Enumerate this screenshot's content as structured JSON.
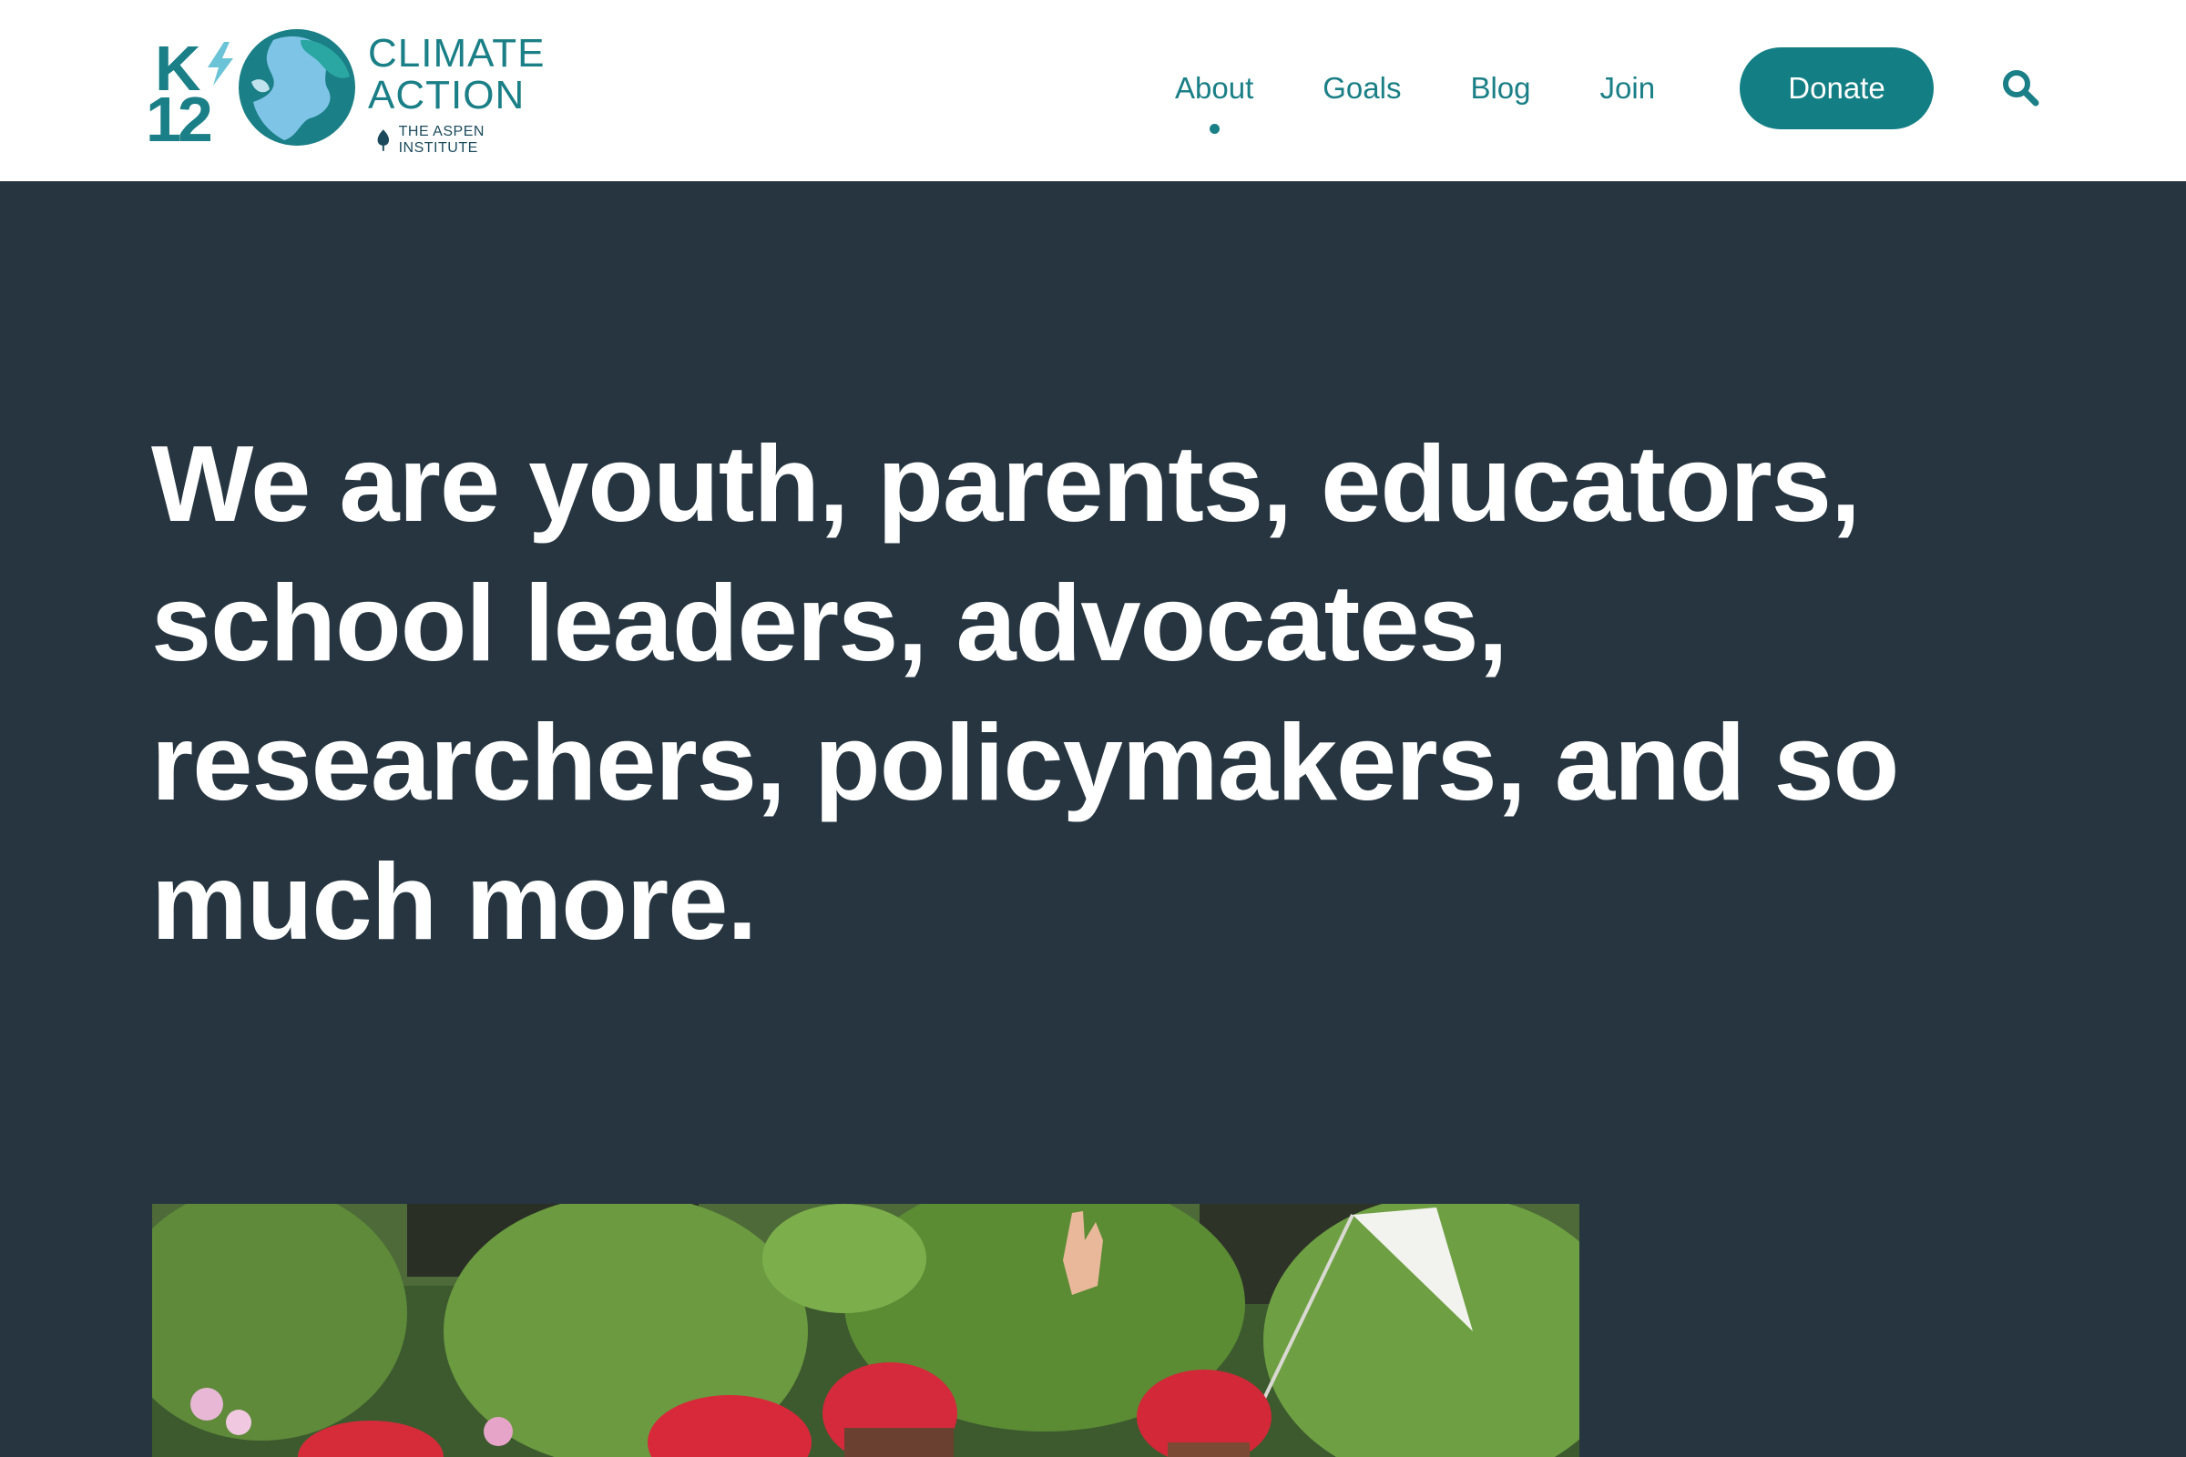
{
  "header": {
    "logo": {
      "k": "K",
      "twelve": "12",
      "line1": "CLIMATE",
      "line2": "ACTION",
      "sub": "THE ASPEN INSTITUTE"
    },
    "nav": [
      {
        "label": "About",
        "active": true
      },
      {
        "label": "Goals",
        "active": false
      },
      {
        "label": "Blog",
        "active": false
      },
      {
        "label": "Join",
        "active": false
      }
    ],
    "donate_label": "Donate",
    "search_icon": "search-icon"
  },
  "hero": {
    "title": "We are youth, parents, educators, school leaders, advocates, researchers, policymakers, and so much more."
  },
  "colors": {
    "brand_teal": "#1a7f86",
    "donate_bg": "#137f85",
    "hero_bg": "#263540",
    "header_bg": "#ffffff"
  }
}
